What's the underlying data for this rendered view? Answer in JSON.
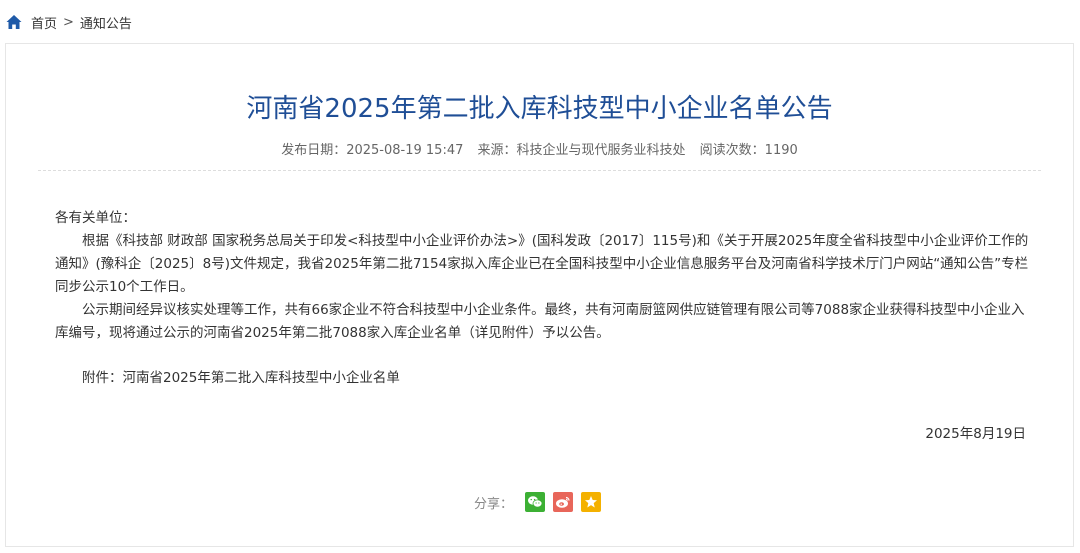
{
  "breadcrumb": {
    "home_label": "首页",
    "separator": ">",
    "current_label": "通知公告"
  },
  "article": {
    "title": "河南省2025年第二批入库科技型中小企业名单公告",
    "meta": {
      "publish_date": "发布日期：2025-08-19 15:47",
      "source": "来源：科技企业与现代服务业科技处",
      "reads": "阅读次数：1190"
    },
    "salutation": "各有关单位：",
    "paragraph_1": "根据《科技部 财政部 国家税务总局关于印发<科技型中小企业评价办法>》(国科发政〔2017〕115号)和《关于开展2025年度全省科技型中小企业评价工作的通知》(豫科企〔2025〕8号)文件规定，我省2025年第二批7154家拟入库企业已在全国科技型中小企业信息服务平台及河南省科学技术厅门户网站“通知公告”专栏同步公示10个工作日。",
    "paragraph_2": "公示期间经异议核实处理等工作，共有66家企业不符合科技型中小企业条件。最终，共有河南厨篮网供应链管理有限公司等7088家企业获得科技型中小企业入库编号，现将通过公示的河南省2025年第二批7088家入库企业名单（详见附件）予以公告。",
    "attachment": "附件：河南省2025年第二批入库科技型中小企业名单",
    "date": "2025年8月19日"
  },
  "share": {
    "label": "分享：",
    "buttons": [
      {
        "icon": "wechat-icon",
        "color": "#3cb034"
      },
      {
        "icon": "weibo-icon",
        "color": "#e8665a"
      },
      {
        "icon": "star-icon",
        "color": "#f4b100"
      }
    ]
  },
  "colors": {
    "title": "#1f4e96",
    "home_icon": "#1f5aa8"
  }
}
